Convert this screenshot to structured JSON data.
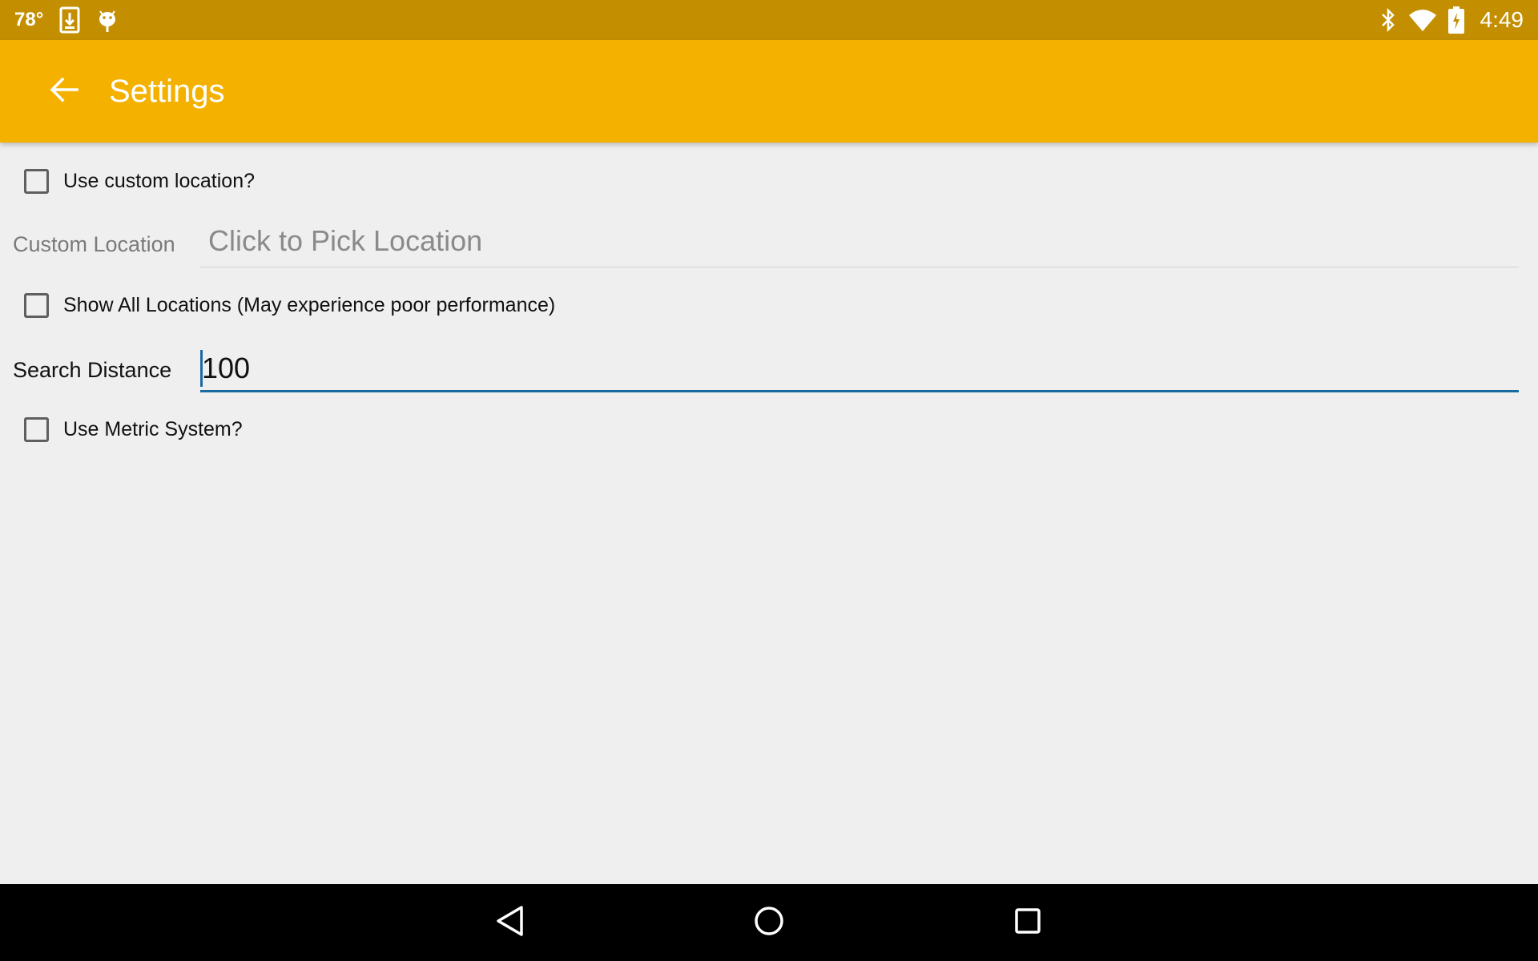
{
  "status_bar": {
    "temperature": "78°",
    "time": "4:49",
    "left_icons": [
      "download-icon",
      "android-icon"
    ],
    "right_icons": [
      "bluetooth-icon",
      "wifi-icon",
      "battery-charging-icon"
    ],
    "background_color": "#c38f00"
  },
  "app_bar": {
    "title": "Settings",
    "back_icon": "arrow-back-icon",
    "background_color": "#f4b100"
  },
  "settings": {
    "use_custom_location": {
      "label": "Use custom location?",
      "checked": false
    },
    "custom_location": {
      "label": "Custom Location",
      "placeholder": "Click to Pick Location"
    },
    "show_all_locations": {
      "label": "Show All Locations (May experience poor performance)",
      "checked": false
    },
    "search_distance": {
      "label": "Search Distance",
      "value": "100",
      "accent_color": "#1a6aa2"
    },
    "use_metric_system": {
      "label": "Use Metric System?",
      "checked": false
    }
  },
  "nav_bar": {
    "buttons": [
      "back-triangle-icon",
      "home-circle-icon",
      "recents-square-icon"
    ]
  }
}
